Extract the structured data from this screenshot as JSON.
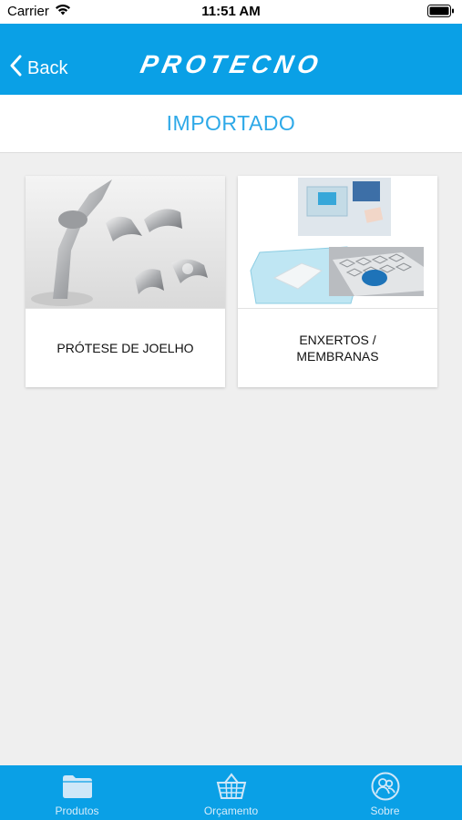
{
  "status": {
    "carrier": "Carrier",
    "time": "11:51 AM"
  },
  "nav": {
    "back_label": "Back",
    "brand": "PROTECNO"
  },
  "page": {
    "title": "IMPORTADO"
  },
  "cards": [
    {
      "label": "PRÓTESE DE JOELHO",
      "image": "knee-prosthesis-image"
    },
    {
      "label": "ENXERTOS /\nMEMBRANAS",
      "image": "grafts-membranes-image"
    }
  ],
  "tabs": [
    {
      "label": "Produtos",
      "icon": "folder-icon"
    },
    {
      "label": "Orçamento",
      "icon": "basket-icon"
    },
    {
      "label": "Sobre",
      "icon": "people-icon"
    }
  ],
  "colors": {
    "brand_blue": "#0aa0e6",
    "title_blue": "#2ea9e8",
    "background": "#efefef"
  }
}
